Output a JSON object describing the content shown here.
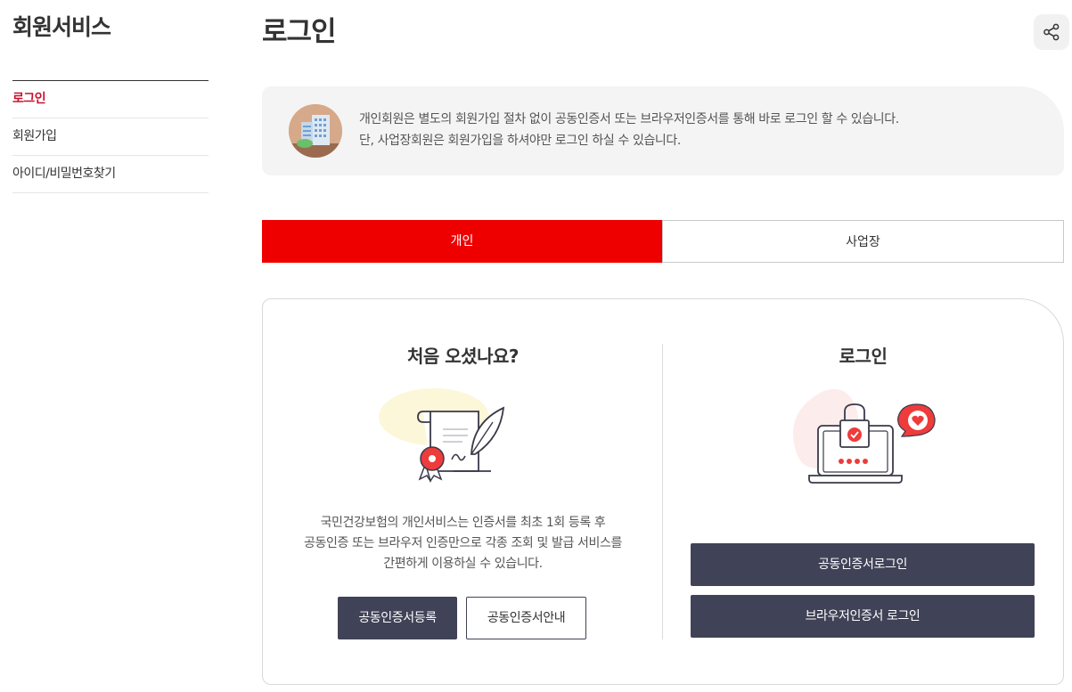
{
  "sidebar": {
    "title": "회원서비스",
    "items": [
      {
        "label": "로그인"
      },
      {
        "label": "회원가입"
      },
      {
        "label": "아이디/비밀번호찾기"
      }
    ]
  },
  "main": {
    "title": "로그인",
    "notice": {
      "line1": "개인회원은 별도의 회원가입 절차 없이 공동인증서 또는 브라우저인증서를 통해 바로 로그인 할 수 있습니다.",
      "line2": "단, 사업장회원은 회원가입을 하셔야만 로그인 하실 수 있습니다."
    },
    "tabs": [
      {
        "label": "개인"
      },
      {
        "label": "사업장"
      }
    ],
    "left": {
      "title": "처음 오셨나요?",
      "desc": [
        "국민건강보험의 개인서비스는 인증서를 최초 1회 등록 후",
        "공동인증 또는 브라우저 인증만으로 각종 조회 및 발급 서비스를",
        "간편하게 이용하실 수 있습니다."
      ],
      "register_button": "공동인증서등록",
      "guide_button": "공동인증서안내"
    },
    "right": {
      "title": "로그인",
      "cert_login_button": "공동인증서로그인",
      "browser_login_button": "브라우저인증서 로그인"
    }
  },
  "colors": {
    "accent_red": "#ee0000",
    "active_menu": "#c8102e",
    "dark_button": "#404257"
  }
}
